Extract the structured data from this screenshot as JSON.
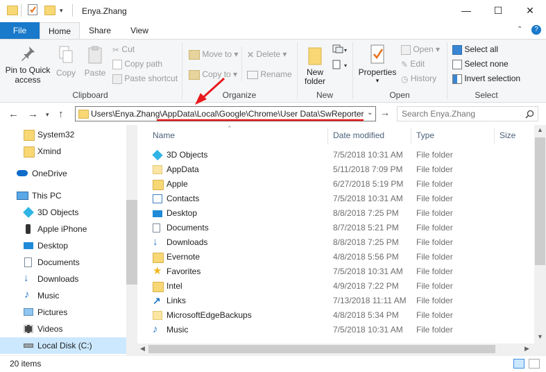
{
  "window": {
    "title": "Enya.Zhang",
    "controls": {
      "minimize": "—",
      "maximize": "☐",
      "close": "✕"
    },
    "help": "?"
  },
  "ribbon_tabs": [
    "File",
    "Home",
    "Share",
    "View"
  ],
  "ribbon": {
    "clipboard": {
      "label": "Clipboard",
      "pin_to_quick_access": [
        "Pin to Quick",
        "access"
      ],
      "copy": "Copy",
      "paste": "Paste",
      "cut": "Cut",
      "copy_path": "Copy path",
      "paste_shortcut": "Paste shortcut"
    },
    "organize": {
      "label": "Organize",
      "move_to": "Move to",
      "copy_to": "Copy to",
      "delete": "Delete",
      "rename": "Rename"
    },
    "new": {
      "label": "New",
      "new_folder": [
        "New",
        "folder"
      ]
    },
    "open": {
      "label": "Open",
      "properties": "Properties",
      "open": "Open",
      "edit": "Edit",
      "history": "History"
    },
    "select": {
      "label": "Select",
      "select_all": "Select all",
      "select_none": "Select none",
      "invert_selection": "Invert selection"
    }
  },
  "address_bar": {
    "path": "Users\\Enya.Zhang\\AppData\\Local\\Google\\Chrome\\User Data\\SwReporter",
    "search_placeholder": "Search Enya.Zhang"
  },
  "nav_pane": [
    {
      "label": "System32",
      "icon": "folder-icon"
    },
    {
      "label": "Xmind",
      "icon": "folder-icon"
    },
    {
      "label": "OneDrive",
      "icon": "onedrive-icon"
    },
    {
      "label": "This PC",
      "icon": "computer-icon"
    },
    {
      "label": "3D Objects",
      "icon": "3d-objects-icon"
    },
    {
      "label": "Apple iPhone",
      "icon": "phone-icon"
    },
    {
      "label": "Desktop",
      "icon": "desktop-icon"
    },
    {
      "label": "Documents",
      "icon": "documents-icon"
    },
    {
      "label": "Downloads",
      "icon": "downloads-icon"
    },
    {
      "label": "Music",
      "icon": "music-icon"
    },
    {
      "label": "Pictures",
      "icon": "pictures-icon"
    },
    {
      "label": "Videos",
      "icon": "videos-icon"
    },
    {
      "label": "Local Disk (C:)",
      "icon": "drive-icon"
    }
  ],
  "columns": {
    "name": "Name",
    "date": "Date modified",
    "type": "Type",
    "size": "Size"
  },
  "files": [
    {
      "name": "3D Objects",
      "date": "7/5/2018 10:31 AM",
      "type": "File folder",
      "icon": "3d-objects-icon"
    },
    {
      "name": "AppData",
      "date": "5/11/2018 7:09 PM",
      "type": "File folder",
      "icon": "folder-icon"
    },
    {
      "name": "Apple",
      "date": "6/27/2018 5:19 PM",
      "type": "File folder",
      "icon": "folder-icon"
    },
    {
      "name": "Contacts",
      "date": "7/5/2018 10:31 AM",
      "type": "File folder",
      "icon": "contacts-icon"
    },
    {
      "name": "Desktop",
      "date": "8/8/2018 7:25 PM",
      "type": "File folder",
      "icon": "desktop-icon"
    },
    {
      "name": "Documents",
      "date": "8/7/2018 5:21 PM",
      "type": "File folder",
      "icon": "documents-icon"
    },
    {
      "name": "Downloads",
      "date": "8/8/2018 7:25 PM",
      "type": "File folder",
      "icon": "downloads-icon"
    },
    {
      "name": "Evernote",
      "date": "4/8/2018 5:56 PM",
      "type": "File folder",
      "icon": "folder-icon"
    },
    {
      "name": "Favorites",
      "date": "7/5/2018 10:31 AM",
      "type": "File folder",
      "icon": "star-icon"
    },
    {
      "name": "Intel",
      "date": "4/9/2018 7:22 PM",
      "type": "File folder",
      "icon": "folder-icon"
    },
    {
      "name": "Links",
      "date": "7/13/2018 11:11 AM",
      "type": "File folder",
      "icon": "links-icon"
    },
    {
      "name": "MicrosoftEdgeBackups",
      "date": "4/8/2018 5:34 PM",
      "type": "File folder",
      "icon": "folder-icon"
    },
    {
      "name": "Music",
      "date": "7/5/2018 10:31 AM",
      "type": "File folder",
      "icon": "music-icon"
    }
  ],
  "status": {
    "item_count": "20 items"
  },
  "colors": {
    "accent": "#1979ca",
    "folder": "#f8d775",
    "annotation": "#e8191c"
  }
}
